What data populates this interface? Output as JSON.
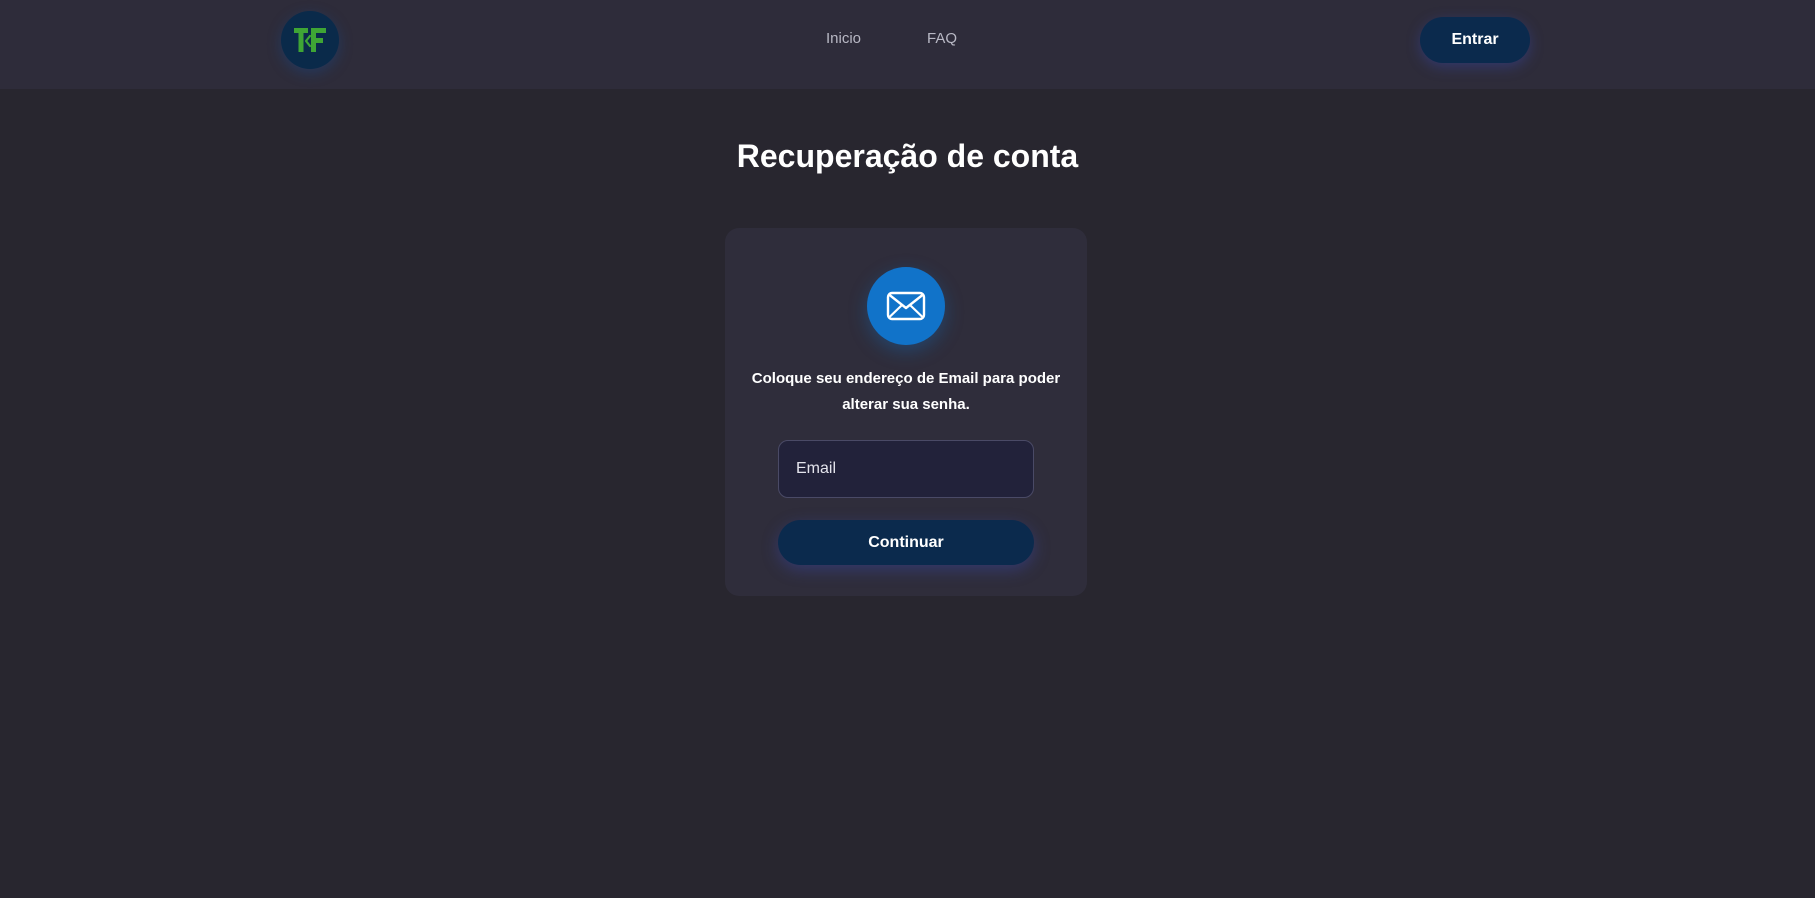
{
  "header": {
    "logo_text": "TF",
    "logo_icon": "tf-logo-icon",
    "nav": [
      {
        "label": "Inicio"
      },
      {
        "label": "FAQ"
      }
    ],
    "login_label": "Entrar"
  },
  "main": {
    "title": "Recuperação de conta",
    "card": {
      "icon": "envelope-icon",
      "description": "Coloque seu endereço de Email para poder alterar sua senha.",
      "email_placeholder": "Email",
      "email_value": "",
      "submit_label": "Continuar"
    }
  },
  "colors": {
    "background": "#28262f",
    "header": "#2e2c3a",
    "card": "#2f2d3b",
    "primary_button": "#0b2a4d",
    "accent_blue": "#1173c9",
    "logo_green": "#3fa535"
  }
}
